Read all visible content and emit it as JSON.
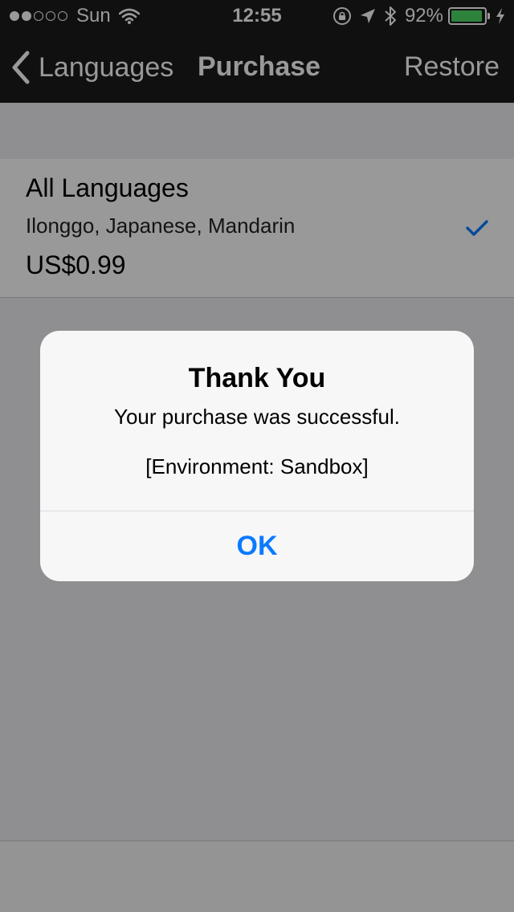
{
  "status_bar": {
    "carrier": "Sun",
    "time": "12:55",
    "battery_percent": "92%",
    "signal_bars_filled": 2,
    "signal_bars_total": 5,
    "icons": [
      "wifi-icon",
      "rotation-lock-icon",
      "location-arrow-icon",
      "bluetooth-icon",
      "battery-icon",
      "charging-bolt-icon"
    ]
  },
  "nav": {
    "back_label": "Languages",
    "title": "Purchase",
    "restore_label": "Restore",
    "back_icon": "chevron-left-icon"
  },
  "product": {
    "title": "All Languages",
    "subtitle": "Ilonggo, Japanese, Mandarin",
    "price": "US$0.99",
    "selected": true,
    "check_icon": "checkmark-icon"
  },
  "alert": {
    "title": "Thank You",
    "message": "Your purchase was successful.",
    "environment": "[Environment: Sandbox]",
    "ok_label": "OK"
  },
  "colors": {
    "bar_background": "#1b1b1b",
    "tint": "#0a7aff",
    "battery_fill": "#4cd964"
  }
}
